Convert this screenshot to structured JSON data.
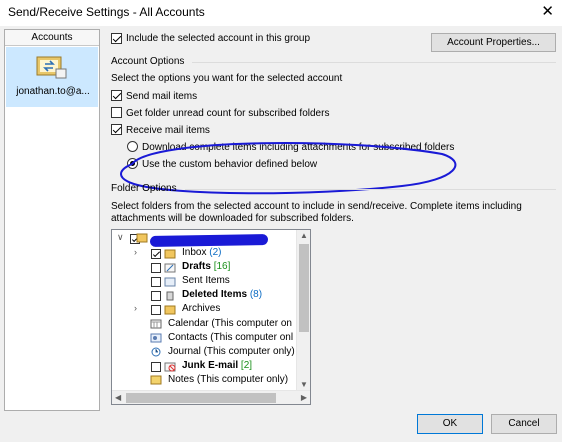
{
  "window": {
    "title": "Send/Receive Settings - All Accounts",
    "close_glyph": "✕"
  },
  "accounts": {
    "header": "Accounts",
    "items": [
      {
        "label": "jonathan.to@a...",
        "icon": "account-sync-icon"
      }
    ]
  },
  "include_group": {
    "label": "Include the selected account in this group",
    "checked": true
  },
  "account_properties_button": "Account Properties...",
  "account_options": {
    "heading": "Account Options",
    "prompt": "Select the options you want for the selected account",
    "send_mail": {
      "label": "Send mail items",
      "checked": true
    },
    "unread_count": {
      "label": "Get folder unread count for subscribed folders",
      "checked": false
    },
    "receive_mail": {
      "label": "Receive mail items",
      "checked": true
    },
    "download_complete": {
      "label": "Download complete items including attachments for subscribed folders",
      "selected": false
    },
    "custom_behavior": {
      "label": "Use the custom behavior defined below",
      "selected": true
    }
  },
  "folder_options": {
    "heading": "Folder Options",
    "description": "Select folders from the selected account to include in send/receive. Complete items including attachments will be downloaded for subscribed folders.",
    "tree": [
      {
        "name": "",
        "count": "",
        "checked": true,
        "bold": false,
        "root": true
      },
      {
        "name": "Inbox",
        "count": "(2)",
        "checked": true,
        "bold": false,
        "icon": "inbox-icon",
        "expandable": true
      },
      {
        "name": "Drafts",
        "count": "[16]",
        "checked": false,
        "bold": true,
        "icon": "drafts-icon"
      },
      {
        "name": "Sent Items",
        "count": "",
        "checked": false,
        "bold": false,
        "icon": "sent-items-icon"
      },
      {
        "name": "Deleted Items",
        "count": "(8)",
        "checked": false,
        "bold": true,
        "icon": "deleted-items-icon"
      },
      {
        "name": "Archives",
        "count": "",
        "checked": false,
        "bold": false,
        "icon": "folder-icon",
        "expandable": true
      },
      {
        "name": "Calendar (This computer on",
        "count": "",
        "checked": null,
        "bold": false,
        "icon": "calendar-icon"
      },
      {
        "name": "Contacts (This computer onl",
        "count": "",
        "checked": null,
        "bold": false,
        "icon": "contacts-icon"
      },
      {
        "name": "Journal (This computer only)",
        "count": "",
        "checked": null,
        "bold": false,
        "icon": "journal-icon"
      },
      {
        "name": "Junk E-mail",
        "count": "[2]",
        "checked": false,
        "bold": true,
        "icon": "junk-email-icon"
      },
      {
        "name": "Notes (This computer only)",
        "count": "",
        "checked": null,
        "bold": false,
        "icon": "notes-icon"
      }
    ]
  },
  "buttons": {
    "ok": "OK",
    "cancel": "Cancel"
  },
  "colors": {
    "accent": "#0078d7",
    "selection": "#cce8ff",
    "annotation": "#1a1ad6"
  }
}
